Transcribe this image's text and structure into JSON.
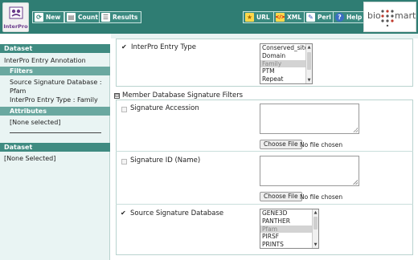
{
  "header": {
    "logo_text": "InterPro",
    "buttons": {
      "new": "New",
      "count": "Count",
      "results": "Results",
      "url": "URL",
      "xml": "XML",
      "perl": "Perl",
      "help": "Help"
    },
    "brand": {
      "left": "bio",
      "right": "mart"
    }
  },
  "sidebar": {
    "dataset1_head": "Dataset",
    "dataset1_value": "InterPro Entry Annotation",
    "filters_head": "Filters",
    "filter1_a": "Source Signature Database :",
    "filter1_b": "Pfam",
    "filter2": "InterPro Entry Type : Family",
    "attributes_head": "Attributes",
    "attributes_value": "[None selected]",
    "dataset2_head": "Dataset",
    "dataset2_value": "[None Selected]"
  },
  "main": {
    "entry_type": {
      "label": "InterPro Entry Type",
      "checked": true,
      "options": [
        "Conserved_site",
        "Domain",
        "Family",
        "PTM",
        "Repeat"
      ],
      "selected": "Family"
    },
    "section_title": "Member Database Signature Filters",
    "section_toggle": "⊟",
    "sig_accession": {
      "label": "Signature Accession",
      "button": "Choose File",
      "no_file": "No file chosen"
    },
    "sig_id": {
      "label": "Signature ID (Name)",
      "button": "Choose File",
      "no_file": "No file chosen"
    },
    "source_db": {
      "label": "Source Signature Database",
      "checked": true,
      "options": [
        "GENE3D",
        "PANTHER",
        "Pfam",
        "PIRSF",
        "PRINTS"
      ],
      "selected": "Pfam"
    }
  },
  "colors": {
    "header_bg": "#2f7d73",
    "sidebar_bg": "#e9f4f3",
    "sidebar_head": "#3f8b81",
    "sidebar_sub": "#6aa8a0"
  }
}
